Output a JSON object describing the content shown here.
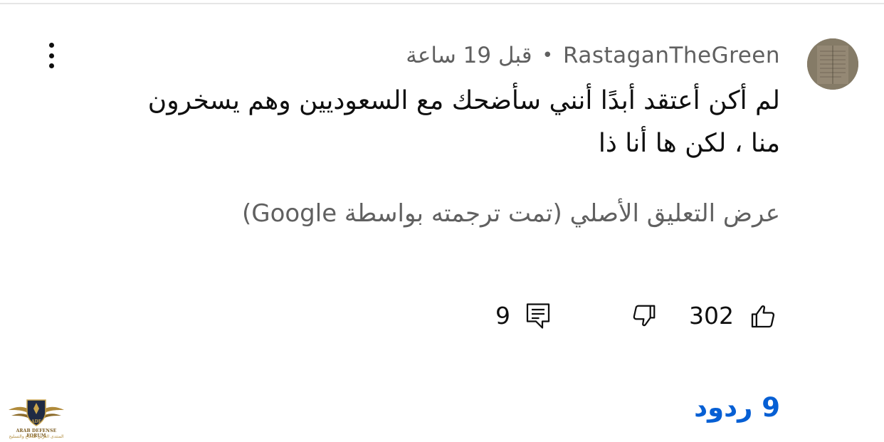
{
  "comment": {
    "author": "RastaganTheGreen",
    "separator": "•",
    "time": "قبل 19 ساعة",
    "text_line1": "لم أكن أعتقد أبدًا أنني سأضحك مع السعوديين وهم يسخرون",
    "text_line2": "منا ، لكن ها أنا ذا",
    "translation_link": "عرض التعليق الأصلي (تمت ترجمته بواسطة Google)",
    "like_count": "302",
    "reply_count": "9",
    "replies_label": "9 ردود"
  },
  "icons": {
    "more": "more-vertical-icon",
    "like": "thumbs-up-icon",
    "dislike": "thumbs-down-icon",
    "reply": "comment-reply-icon"
  },
  "colors": {
    "text_primary": "#0f0f0f",
    "text_secondary": "#606060",
    "link_blue": "#065fd4"
  },
  "watermark": {
    "logo_text": "ADF",
    "en": "ARAB DEFENSE FORUM",
    "ar": "المنتدى العربي للدفاع والتسليح"
  }
}
